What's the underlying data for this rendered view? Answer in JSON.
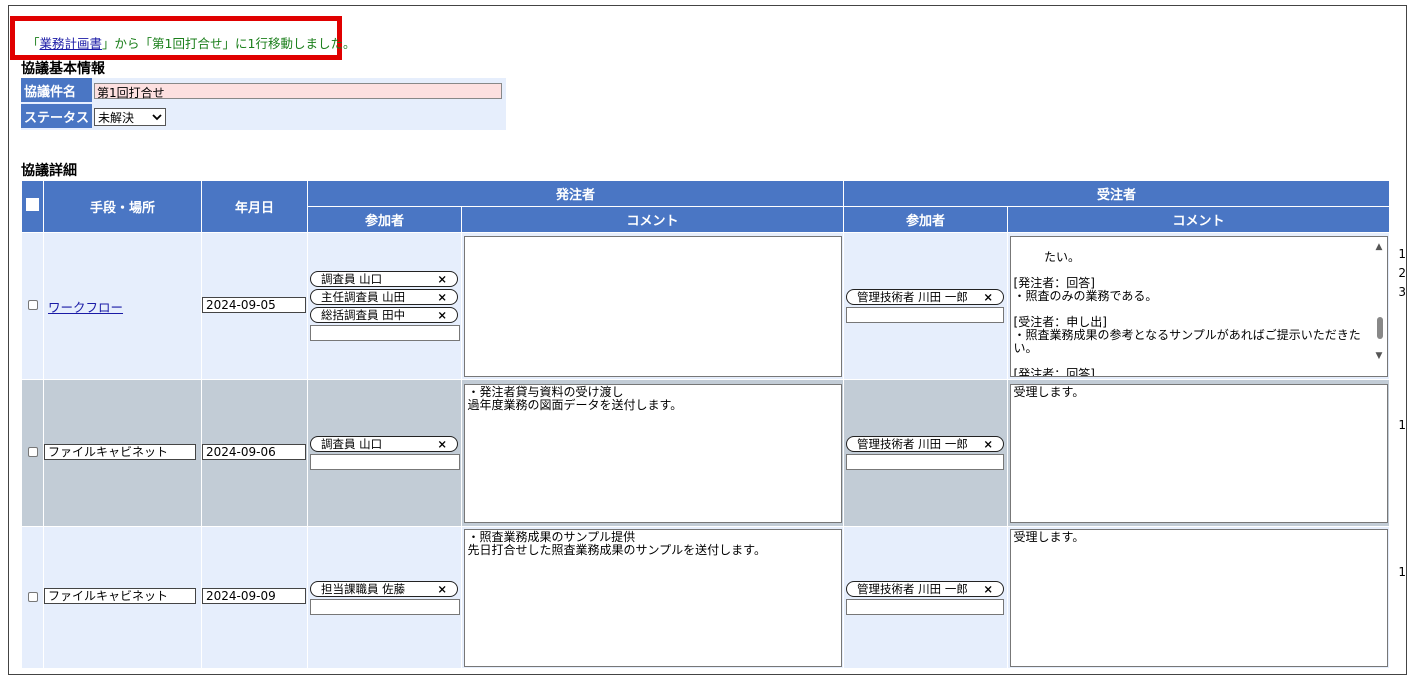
{
  "notice": {
    "prefix": "「",
    "link": "業務計画書",
    "suffix": "」から「第1回打合せ」に1行移動しました。"
  },
  "basic_info": {
    "title": "協議基本情報",
    "subject_label": "協議件名",
    "subject_value": "第1回打合せ",
    "status_label": "ステータス",
    "status_value": "未解決"
  },
  "details": {
    "title": "協議詳細",
    "headers": {
      "method": "手段・場所",
      "date": "年月日",
      "orderer": "発注者",
      "contractor": "受注者",
      "participants": "参加者",
      "comment": "コメント"
    },
    "rows": [
      {
        "method": "ワークフロー",
        "method_is_link": true,
        "date": "2024-09-05",
        "orderer_participants": [
          "調査員 山口",
          "主任調査員 山田",
          "総括調査員 田中"
        ],
        "orderer_comment": "",
        "contractor_participants": [
          "管理技術者 川田 一郎"
        ],
        "contractor_comment": "たい。\n\n[発注者：回答]\n・照査のみの業務である。\n\n[受注者：申し出]\n・照査業務成果の参考となるサンプルがあればご提示いただきたい。\n\n[発注者：回答]\n・サンプル成果品を送付する。\n(以上)",
        "edge_numbers": [
          "1",
          "2",
          "3"
        ]
      },
      {
        "method": "ファイルキャビネット",
        "method_is_link": false,
        "date": "2024-09-06",
        "orderer_participants": [
          "調査員 山口"
        ],
        "orderer_comment": "・発注者貸与資料の受け渡し\n過年度業務の図面データを送付します。",
        "contractor_participants": [
          "管理技術者 川田 一郎"
        ],
        "contractor_comment": "受理します。",
        "edge_numbers": [
          "1"
        ]
      },
      {
        "method": "ファイルキャビネット",
        "method_is_link": false,
        "date": "2024-09-09",
        "orderer_participants": [
          "担当課職員 佐藤"
        ],
        "orderer_comment": "・照査業務成果のサンプル提供\n先日打合せした照査業務成果のサンプルを送付します。",
        "contractor_participants": [
          "管理技術者 川田 一郎"
        ],
        "contractor_comment": "受理します。",
        "edge_numbers": [
          "1"
        ]
      }
    ]
  },
  "icons": {
    "remove": "×",
    "dropdown": "chevron-down-icon"
  },
  "colors": {
    "header_blue": "#4a76c4",
    "row_light": "#e6eefc",
    "row_gray": "#c2ccd6",
    "notice_border": "#e00000",
    "subject_bg": "#fde0e0"
  }
}
